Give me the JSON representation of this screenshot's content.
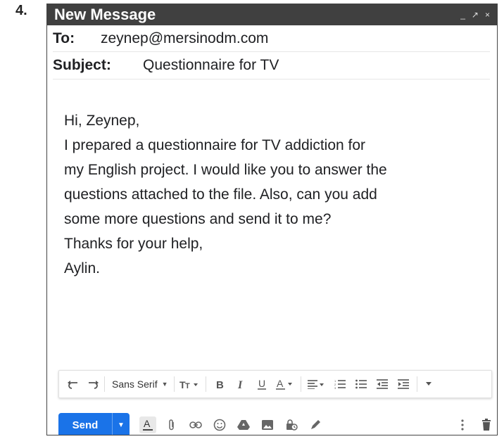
{
  "question_number": "4.",
  "window": {
    "title": "New Message",
    "controls": [
      "_",
      "↗",
      "×"
    ]
  },
  "to": {
    "label": "To:",
    "value": "zeynep@mersinodm.com"
  },
  "subject": {
    "label": "Subject:",
    "value": "Questionnaire for TV"
  },
  "body_lines": [
    "Hi, Zeynep,",
    "I prepared a questionnaire for TV addiction for",
    "my English project. I would like you to answer the",
    "questions attached to the file. Also, can you add",
    "some more questions and send it to me?",
    "Thanks for your help,",
    "Aylin."
  ],
  "formatting_toolbar": {
    "font": "Sans Serif",
    "icons": [
      "undo-icon",
      "redo-icon",
      "font-size-icon",
      "bold-icon",
      "italic-icon",
      "underline-icon",
      "text-color-icon",
      "align-icon",
      "numbered-list-icon",
      "bulleted-list-icon",
      "indent-less-icon",
      "indent-more-icon",
      "more-formatting-icon"
    ]
  },
  "bottom_bar": {
    "send_label": "Send",
    "icons": [
      "formatting-options-icon",
      "attach-icon",
      "link-icon",
      "emoji-icon",
      "drive-icon",
      "photo-icon",
      "confidential-icon",
      "signature-icon",
      "more-options-icon",
      "trash-icon"
    ]
  },
  "colors": {
    "titlebar": "#404040",
    "send_button": "#1a73e8",
    "text": "#202124"
  }
}
